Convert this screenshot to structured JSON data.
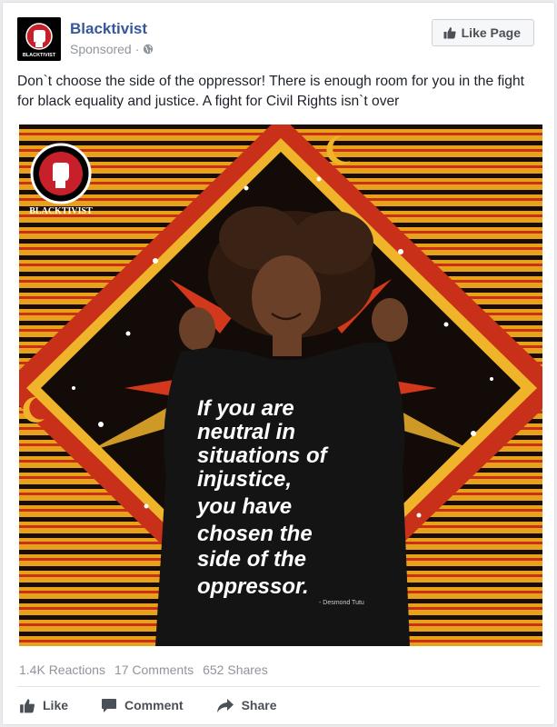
{
  "post": {
    "page_name": "Blacktivist",
    "sponsored_label": "Sponsored",
    "separator": "·",
    "like_page_label": "Like Page",
    "text": "Don`t choose the side of the oppressor! There is enough room for you in the fight for black equality and justice. A fight for Civil Rights isn`t over"
  },
  "avatar": {
    "brand_text": "BLACKTIVIST"
  },
  "image": {
    "watermark": "BLACKTIVIST",
    "shirt_lines": [
      "If you are",
      "neutral in",
      "situations of",
      "injustice,",
      "you have",
      "chosen the",
      "side of the",
      "oppressor."
    ],
    "shirt_attribution": "- Desmond Tutu"
  },
  "stats": {
    "reactions": "1.4K Reactions",
    "comments": "17 Comments",
    "shares": "652 Shares"
  },
  "actions": {
    "like": "Like",
    "comment": "Comment",
    "share": "Share"
  },
  "colors": {
    "link_blue": "#365899",
    "meta_gray": "#90949c",
    "button_text": "#4b4f56"
  },
  "icons": [
    "thumbs-up-icon",
    "globe-icon",
    "comment-icon",
    "share-icon",
    "raised-fist-icon"
  ]
}
